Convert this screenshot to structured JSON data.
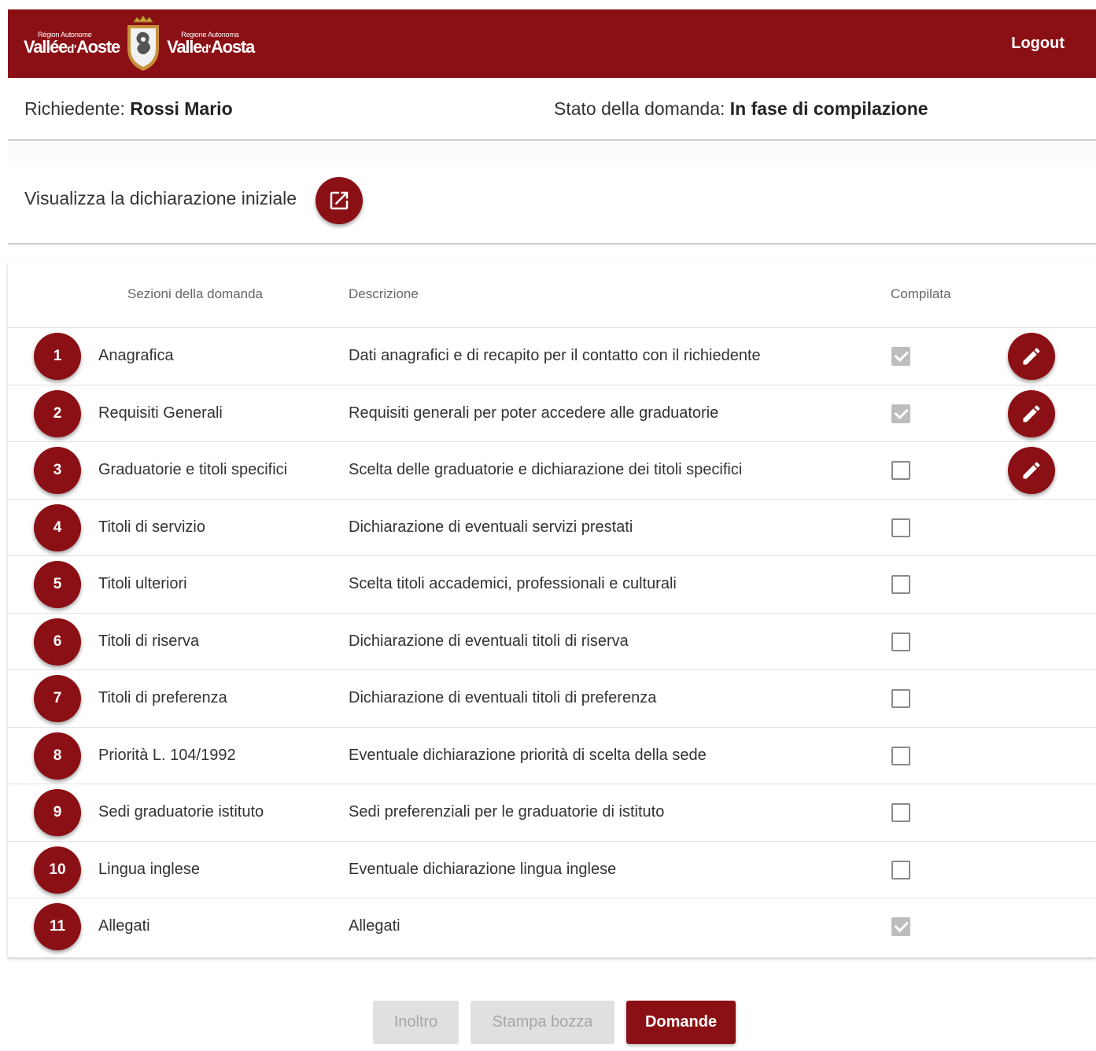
{
  "header": {
    "logo_left_small": "Région Autonome",
    "logo_left_main": "Vallée",
    "logo_left_d": "d'",
    "logo_left_end": "Aoste",
    "logo_right_small": "Regione Autonoma",
    "logo_right_main": "Valle",
    "logo_right_d": "d'",
    "logo_right_end": "Aosta",
    "logout_label": "Logout"
  },
  "info": {
    "applicant_label": "Richiedente: ",
    "applicant_name": "Rossi Mario",
    "status_label": "Stato della domanda: ",
    "status_value": "In fase di compilazione"
  },
  "declaration": {
    "label": "Visualizza la dichiarazione iniziale"
  },
  "table": {
    "headers": {
      "sections": "Sezioni della domanda",
      "description": "Descrizione",
      "completed": "Compilata"
    },
    "rows": [
      {
        "num": "1",
        "section": "Anagrafica",
        "description": "Dati anagrafici e di recapito per il contatto con il richiedente",
        "completed": true,
        "editable": true
      },
      {
        "num": "2",
        "section": "Requisiti Generali",
        "description": "Requisiti generali per poter accedere alle graduatorie",
        "completed": true,
        "editable": true
      },
      {
        "num": "3",
        "section": "Graduatorie e titoli specifici",
        "description": "Scelta delle graduatorie e dichiarazione dei titoli specifici",
        "completed": false,
        "editable": true
      },
      {
        "num": "4",
        "section": "Titoli di servizio",
        "description": "Dichiarazione di eventuali servizi prestati",
        "completed": false,
        "editable": false
      },
      {
        "num": "5",
        "section": "Titoli ulteriori",
        "description": "Scelta titoli accademici, professionali e culturali",
        "completed": false,
        "editable": false
      },
      {
        "num": "6",
        "section": "Titoli di riserva",
        "description": "Dichiarazione di eventuali titoli di riserva",
        "completed": false,
        "editable": false
      },
      {
        "num": "7",
        "section": "Titoli di preferenza",
        "description": "Dichiarazione di eventuali titoli di preferenza",
        "completed": false,
        "editable": false
      },
      {
        "num": "8",
        "section": "Priorità L. 104/1992",
        "description": "Eventuale dichiarazione priorità di scelta della sede",
        "completed": false,
        "editable": false
      },
      {
        "num": "9",
        "section": "Sedi graduatorie istituto",
        "description": "Sedi preferenziali per le graduatorie di istituto",
        "completed": false,
        "editable": false
      },
      {
        "num": "10",
        "section": "Lingua inglese",
        "description": "Eventuale dichiarazione lingua inglese",
        "completed": false,
        "editable": false
      },
      {
        "num": "11",
        "section": "Allegati",
        "description": "Allegati",
        "completed": true,
        "editable": false
      }
    ]
  },
  "actions": {
    "forward_label": "Inoltro",
    "print_label": "Stampa bozza",
    "applications_label": "Domande"
  },
  "colors": {
    "brand": "#8b1015",
    "disabled_bg": "#e0e0e0",
    "disabled_text": "#a6a6a6"
  }
}
